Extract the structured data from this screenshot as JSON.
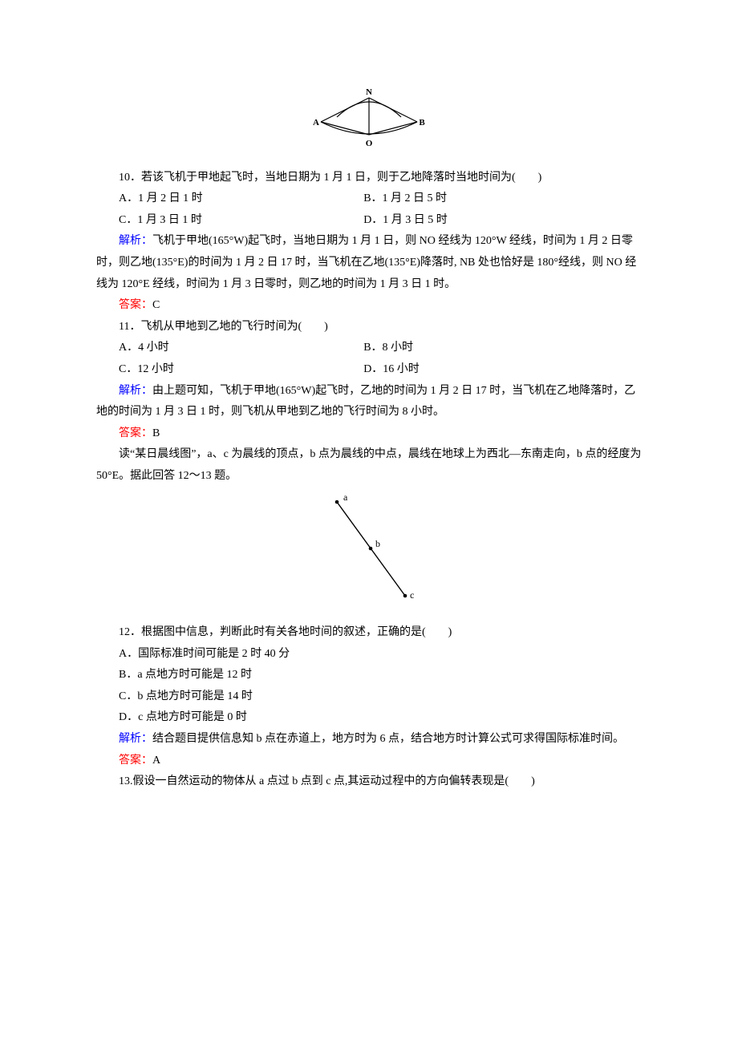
{
  "figure1": {
    "labels": {
      "n": "N",
      "o": "O",
      "a": "A",
      "b": "B"
    }
  },
  "q10": {
    "stem": "10．若该飞机于甲地起飞时，当地日期为 1 月 1 日，则于乙地降落时当地时间为(　　)",
    "optA": "A．1 月 2 日 1 时",
    "optB": "B．1 月 2 日 5 时",
    "optC": "C．1 月 3 日 1 时",
    "optD": "D．1 月 3 日 5 时",
    "analysisLabel": "解析：",
    "analysis": "飞机于甲地(165°W)起飞时，当地日期为 1 月 1 日，则 NO 经线为 120°W 经线，时间为 1 月 2 日零时，则乙地(135°E)的时间为 1 月 2 日 17 时，当飞机在乙地(135°E)降落时, NB 处也恰好是 180°经线，则 NO 经线为 120°E 经线，时间为 1 月 3 日零时，则乙地的时间为 1 月 3 日 1 时。",
    "answerLabel": "答案：",
    "answer": "C"
  },
  "q11": {
    "stem": "11．飞机从甲地到乙地的飞行时间为(　　)",
    "optA": "A．4 小时",
    "optB": "B．8 小时",
    "optC": "C．12 小时",
    "optD": "D．16 小时",
    "analysisLabel": "解析：",
    "analysis": "由上题可知，飞机于甲地(165°W)起飞时，乙地的时间为 1 月 2 日 17 时，当飞机在乙地降落时，乙地的时间为 1 月 3 日 1 时，则飞机从甲地到乙地的飞行时间为 8 小时。",
    "answerLabel": "答案：",
    "answer": "B"
  },
  "passage2": {
    "text": "读“某日晨线图”，a、c 为晨线的顶点，b 点为晨线的中点，晨线在地球上为西北—东南走向，b 点的经度为 50°E。据此回答 12～13 题。"
  },
  "figure2": {
    "labels": {
      "a": "a",
      "b": "b",
      "c": "c"
    }
  },
  "q12": {
    "stem": "12．根据图中信息，判断此时有关各地时间的叙述，正确的是(　　)",
    "optA": "A．国际标准时间可能是 2 时 40 分",
    "optB": "B．a 点地方时可能是 12 时",
    "optC": "C．b 点地方时可能是 14 时",
    "optD": "D．c 点地方时可能是 0 时",
    "analysisLabel": "解析：",
    "analysis": "结合题目提供信息知 b 点在赤道上，地方时为 6 点，结合地方时计算公式可求得国际标准时间。",
    "answerLabel": "答案：",
    "answer": "A"
  },
  "q13": {
    "stem": "13.假设一自然运动的物体从 a 点过 b 点到 c 点,其运动过程中的方向偏转表现是(　　)"
  }
}
